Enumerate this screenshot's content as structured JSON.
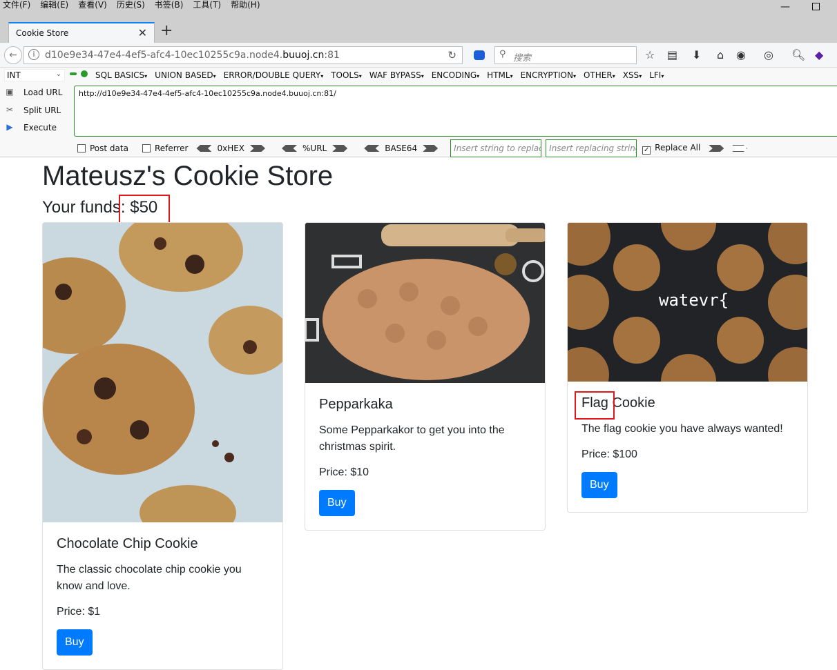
{
  "menubar": {
    "items": [
      "文件(F)",
      "编辑(E)",
      "查看(V)",
      "历史(S)",
      "书签(B)",
      "工具(T)",
      "帮助(H)"
    ]
  },
  "tab": {
    "title": "Cookie Store"
  },
  "address": {
    "url_prefix": "d10e9e34-47e4-4ef5-afc4-10ec10255c9a.node4.",
    "url_domain": "buuoj.cn",
    "url_suffix": ":81"
  },
  "search": {
    "placeholder": "搜索"
  },
  "hackbar": {
    "select_value": "INT",
    "menus": [
      "SQL BASICS",
      "UNION BASED",
      "ERROR/DOUBLE QUERY",
      "TOOLS",
      "WAF BYPASS",
      "ENCODING",
      "HTML",
      "ENCRYPTION",
      "OTHER",
      "XSS",
      "LFI"
    ],
    "actions": [
      "Load URL",
      "Split URL",
      "Execute"
    ],
    "textarea_value": "http://d10e9e34-47e4-4ef5-afc4-10ec10255c9a.node4.buuoj.cn:81/",
    "post_data": "Post data",
    "referrer": "Referrer",
    "hex": "0xHEX",
    "url": "%URL",
    "base64": "BASE64",
    "insert_placeholder": "Insert string to replace",
    "replacing_placeholder": "Insert replacing string",
    "replace_all": "Replace All"
  },
  "page": {
    "title": "Mateusz's Cookie Store",
    "funds_label": "Your funds:",
    "funds_value": "$50"
  },
  "products": [
    {
      "name": "Chocolate Chip Cookie",
      "description": "The classic chocolate chip cookie you know and love.",
      "price": "Price: $1",
      "button": "Buy"
    },
    {
      "name": "Pepparkaka",
      "description": "Some Pepparkakor to get you into the christmas spirit.",
      "price": "Price: $10",
      "button": "Buy"
    },
    {
      "name": "Flag Cookie",
      "description": "The flag cookie you have always wanted!",
      "price": "Price: $100",
      "button": "Buy",
      "image_text": "watevr{"
    }
  ],
  "colors": {
    "primary": "#007bff",
    "highlight": "#e0161b",
    "hackbar_green": "#2a8a2a"
  }
}
